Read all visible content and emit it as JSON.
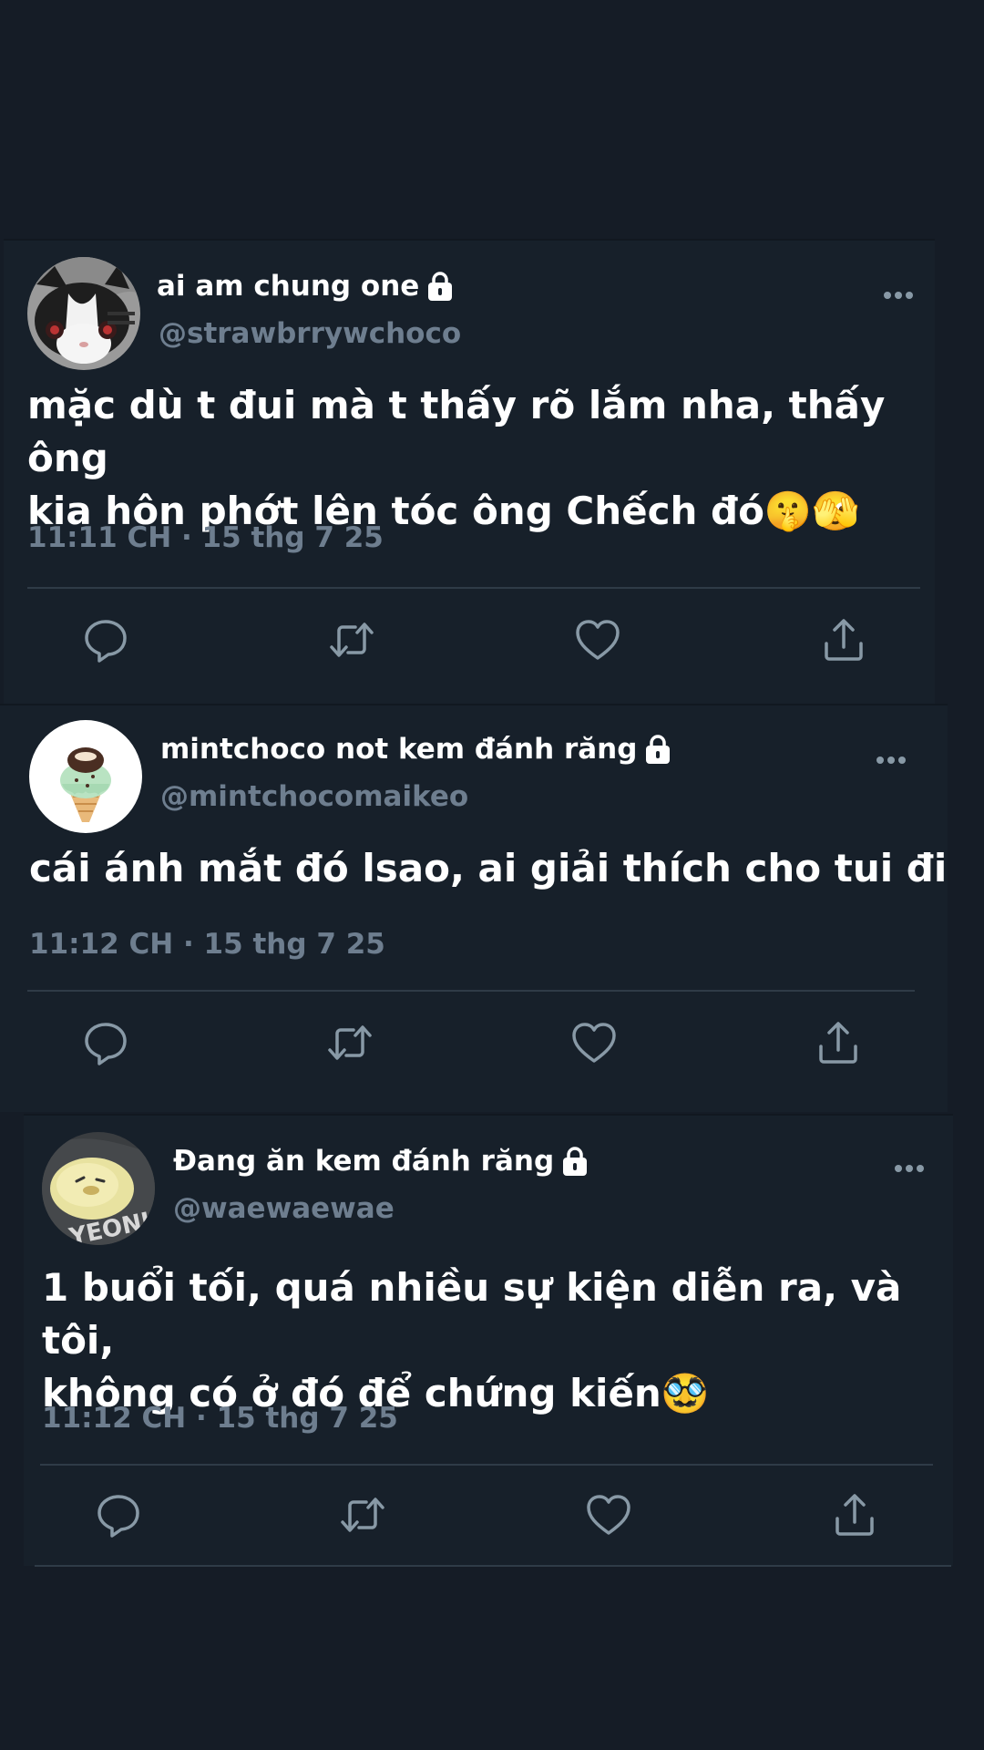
{
  "tweets": [
    {
      "display_name": "ai am chung one",
      "handle": "@strawbrrywchoco",
      "text": "mặc dù t đui mà t thấy rõ lắm nha, thấy ông\nkia hôn phớt lên tóc ông Chếch đó🤫🫣",
      "timestamp": "11:11 CH · 15 thg 7 25",
      "avatar_icon": "cat-avatar",
      "locked": true
    },
    {
      "display_name": "mintchoco not kem đánh răng",
      "handle": "@mintchocomaikeo",
      "text": "cái ánh mắt đó lsao, ai giải thích cho tui đi",
      "timestamp": "11:12 CH · 15 thg 7 25",
      "avatar_icon": "ice-cream-avatar",
      "locked": true
    },
    {
      "display_name": "Đang ăn kem đánh răng",
      "handle": "@waewaewae",
      "text": "1 buổi tối, quá nhiều sự kiện diễn ra, và tôi,\nkhông có ở đó để chứng kiến🥸",
      "timestamp": "11:12 CH · 15 thg 7 25",
      "avatar_icon": "duck-avatar",
      "locked": true
    }
  ],
  "icons": {
    "more": "more-horizontal-icon",
    "reply": "reply-icon",
    "retweet": "retweet-icon",
    "like": "heart-icon",
    "share": "share-icon",
    "lock": "lock-icon"
  },
  "colors": {
    "background": "#151c26",
    "card": "#17202a",
    "secondary_text": "#6e7e8f",
    "icon": "#8899a6",
    "divider": "#2f3b47"
  }
}
